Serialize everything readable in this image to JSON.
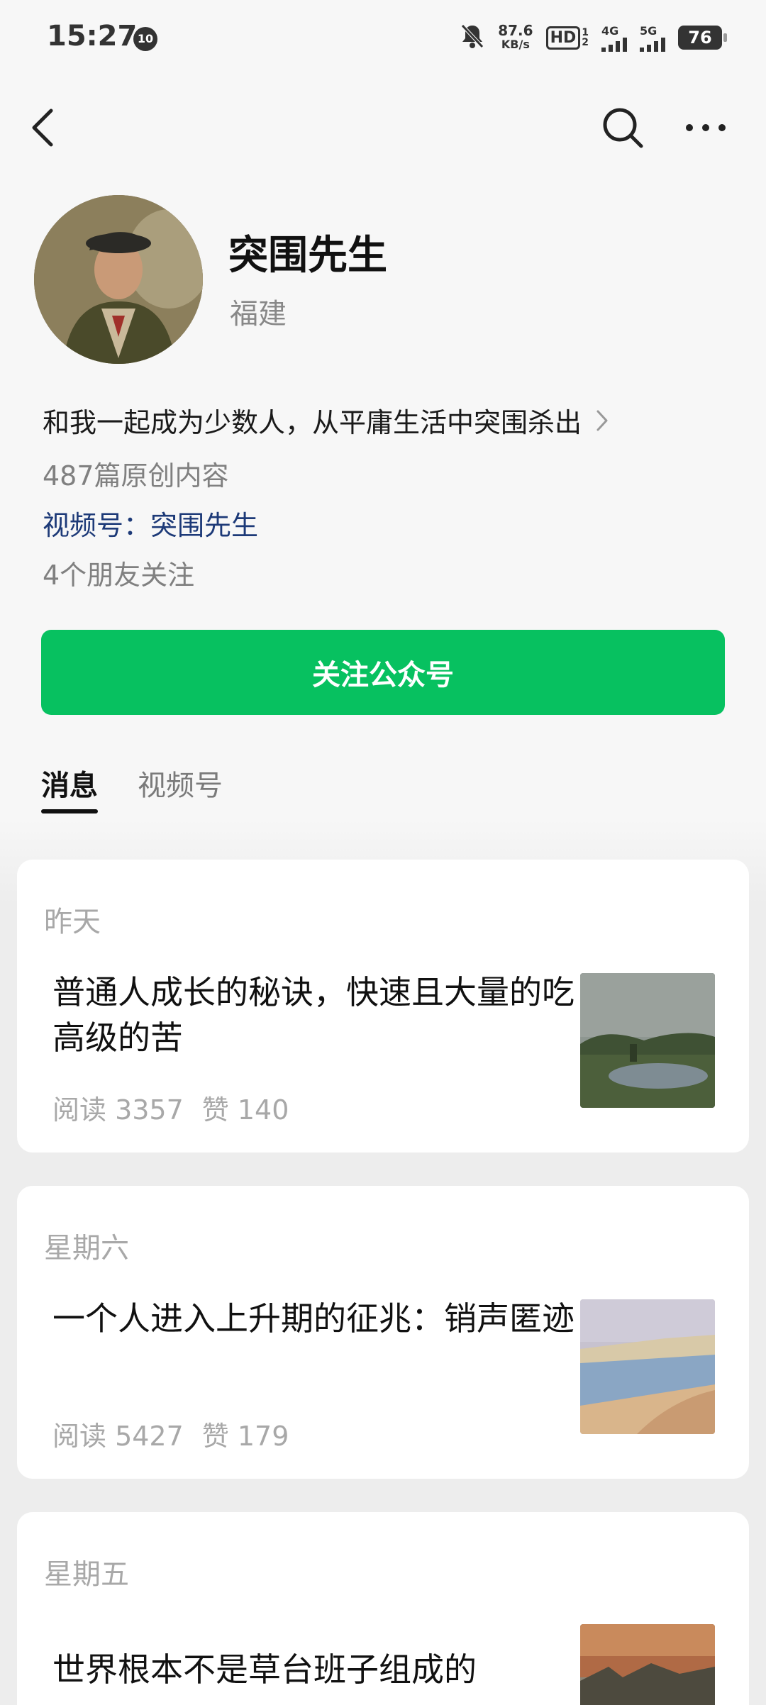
{
  "status_bar": {
    "time": "15:27",
    "badge": "10",
    "speed_value": "87.6",
    "speed_unit": "KB/s",
    "hd": "HD",
    "hd_sub_top": "1",
    "hd_sub_bottom": "2",
    "net_4g": "4G",
    "net_5g": "5G",
    "battery": "76"
  },
  "nav": {
    "back_icon": "chevron-left-icon",
    "search_icon": "search-icon",
    "more_icon": "more-horizontal-icon"
  },
  "profile": {
    "name": "突围先生",
    "region": "福建",
    "bio": "和我一起成为少数人，从平庸生活中突围杀出",
    "original_count": "487篇原创内容",
    "channel_prefix": "视频号：",
    "channel_name": "突围先生",
    "friends_following": "4个朋友关注",
    "follow_button": "关注公众号"
  },
  "tabs": [
    {
      "label": "消息",
      "active": true
    },
    {
      "label": "视频号",
      "active": false
    }
  ],
  "articles": [
    {
      "date": "昨天",
      "title": "普通人成长的秘诀，快速且大量的吃高级的苦",
      "reads": "阅读 3357",
      "likes": "赞 140"
    },
    {
      "date": "星期六",
      "title": "一个人进入上升期的征兆：销声匿迹",
      "reads": "阅读 5427",
      "likes": "赞 179"
    },
    {
      "date": "星期五",
      "title": "世界根本不是草台班子组成的",
      "reads": "",
      "likes": ""
    }
  ],
  "colors": {
    "accent_green": "#07c160",
    "link_blue": "#1d3a78"
  }
}
